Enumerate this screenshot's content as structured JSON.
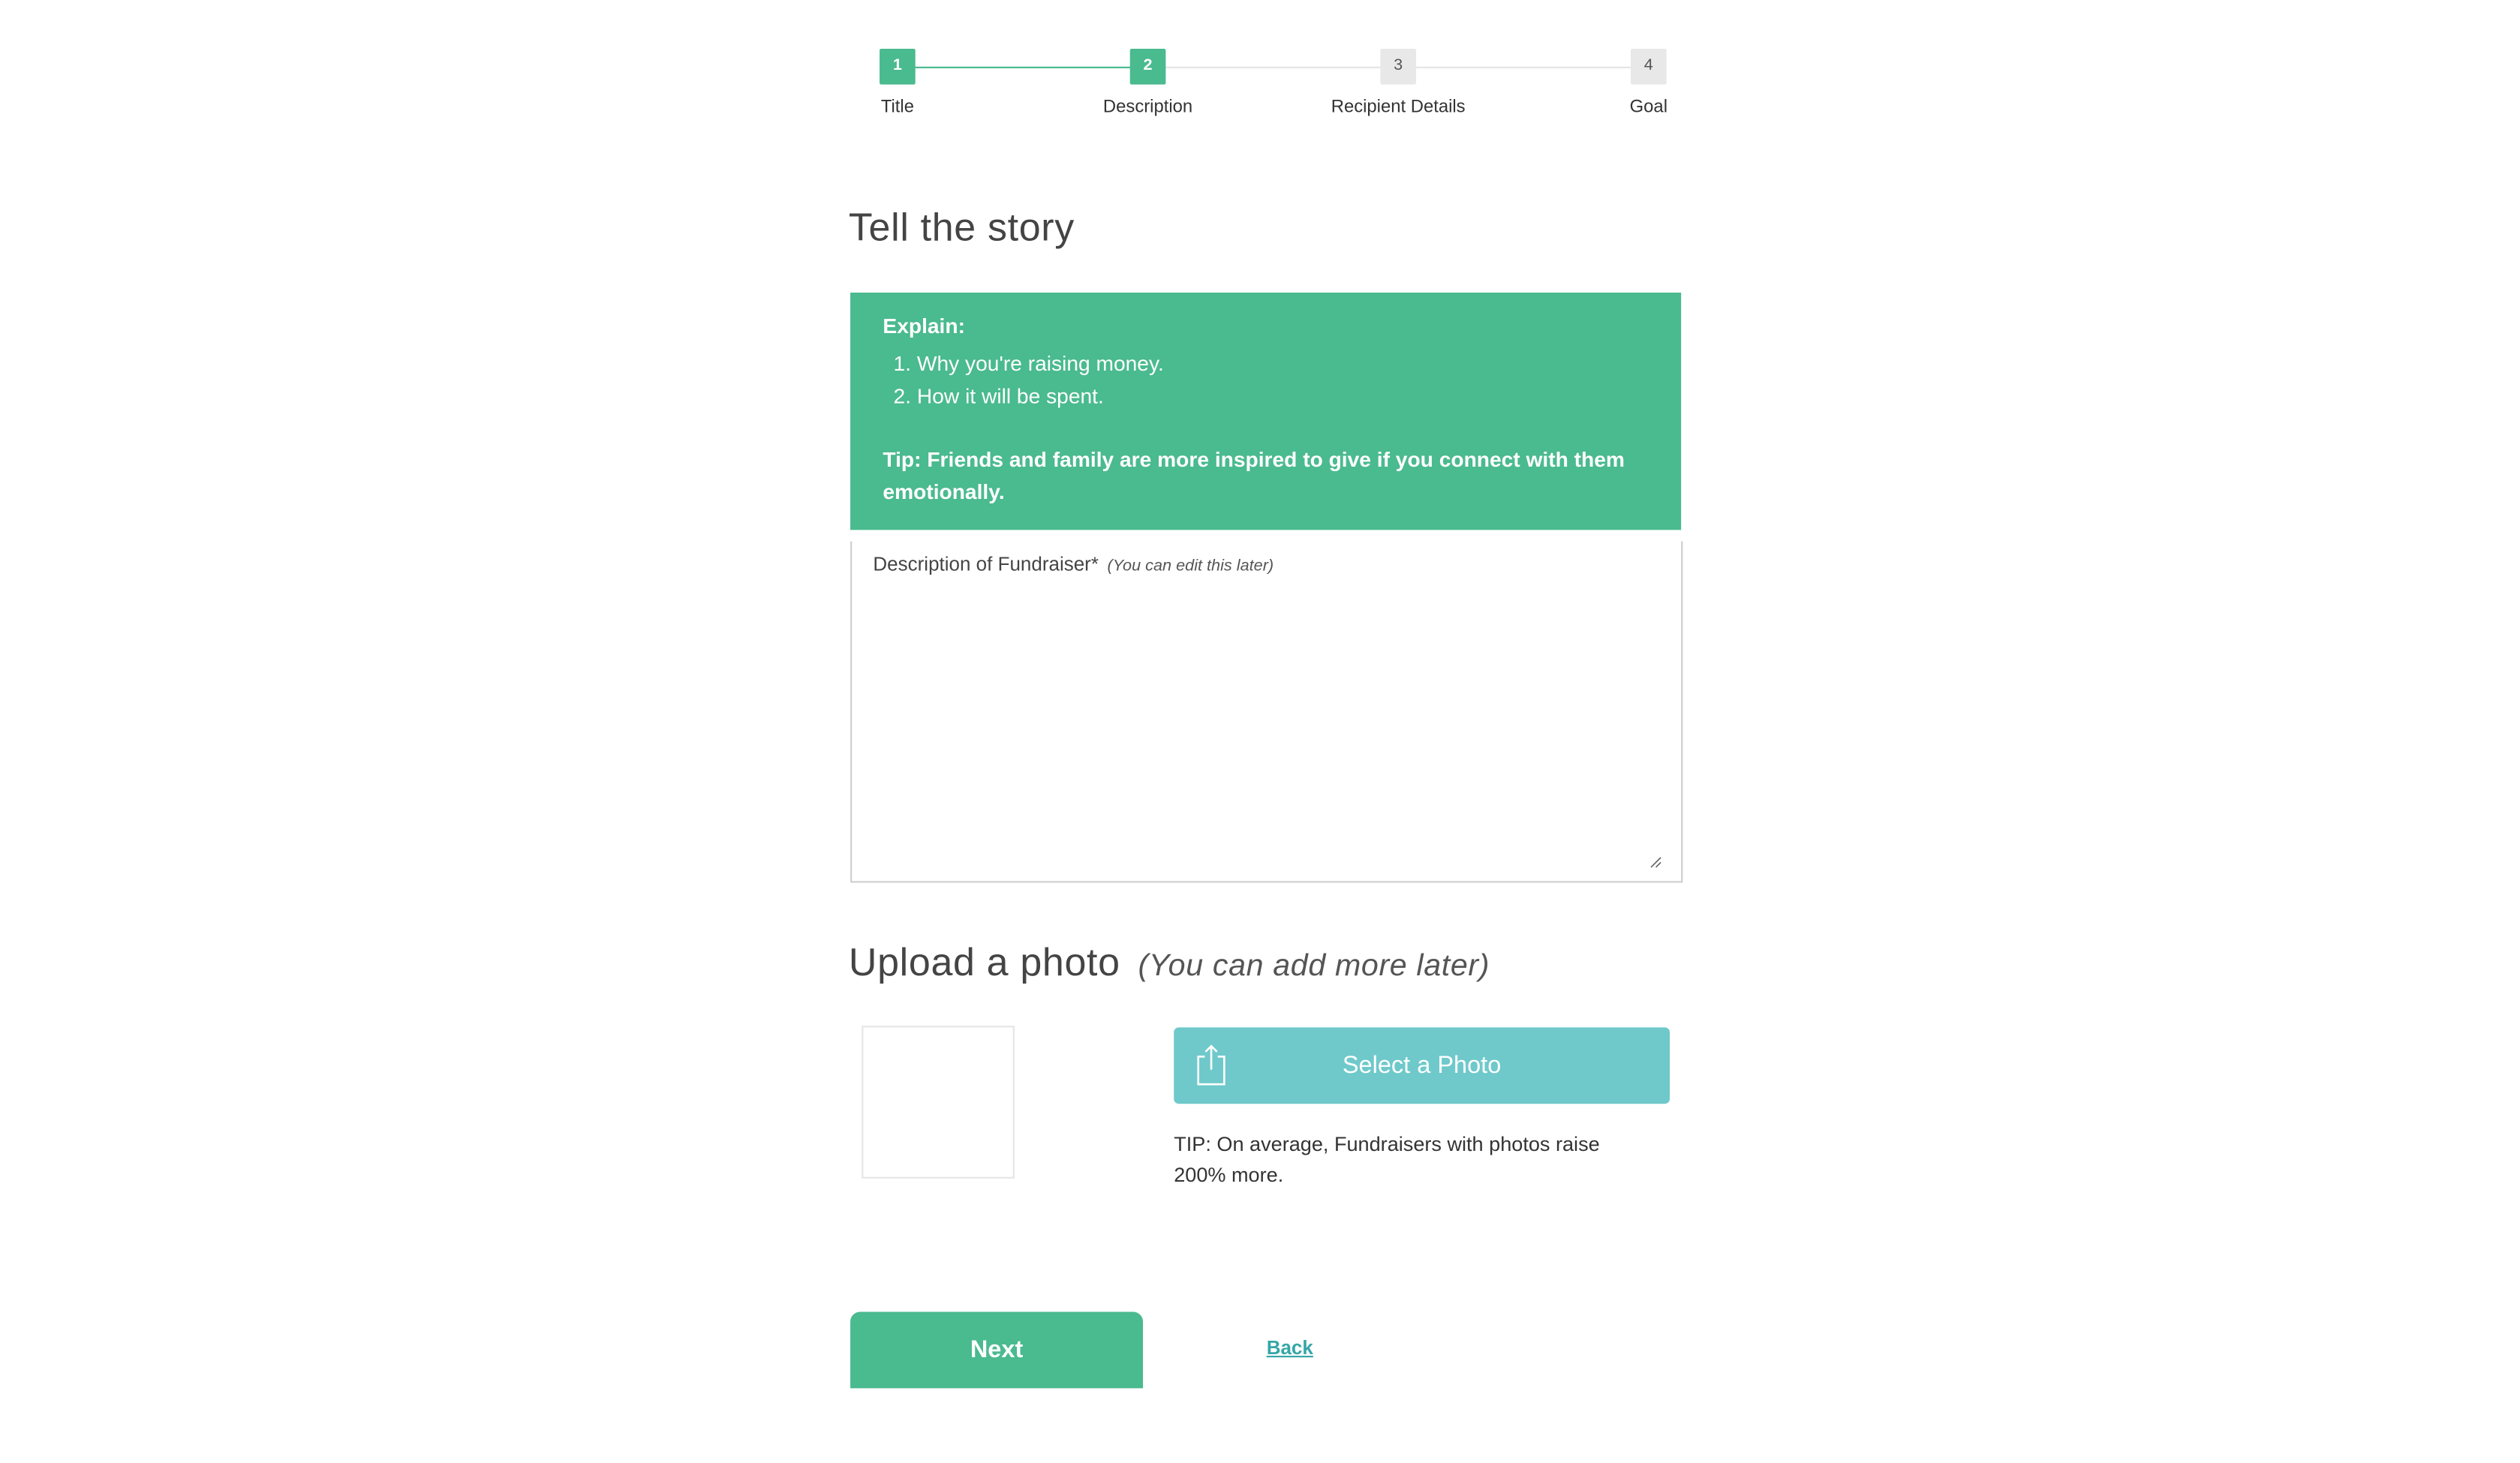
{
  "stepper": {
    "steps": [
      {
        "number": "1",
        "label": "Title",
        "state": "complete"
      },
      {
        "number": "2",
        "label": "Description",
        "state": "current"
      },
      {
        "number": "3",
        "label": "Recipient Details",
        "state": "upcoming"
      },
      {
        "number": "4",
        "label": "Goal",
        "state": "upcoming"
      }
    ]
  },
  "story": {
    "heading": "Tell the story",
    "explain_title": "Explain:",
    "explain_items": [
      "Why you're raising money.",
      "How it will be spent."
    ],
    "tip": "Tip: Friends and family are more inspired to give if you connect with them emotionally."
  },
  "description_field": {
    "label": "Description of Fundraiser*",
    "hint": "(You can edit this later)",
    "value": ""
  },
  "photo": {
    "heading": "Upload a photo",
    "heading_sub": "(You can add more later)",
    "button_label": "Select a Photo",
    "button_icon": "upload-icon",
    "tip": "TIP: On average, Fundraisers with photos raise 200% more."
  },
  "actions": {
    "next_label": "Next",
    "back_label": "Back"
  },
  "colors": {
    "accent_green": "#4aba8f",
    "photo_button": "#6fc9cb",
    "link": "#36a6a8",
    "inactive_step": "#e8e8e8"
  }
}
